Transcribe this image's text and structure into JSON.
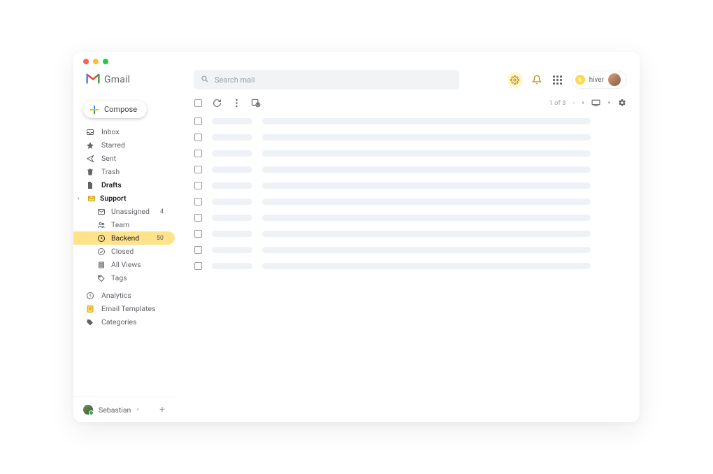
{
  "app": {
    "name": "Gmail"
  },
  "search": {
    "placeholder": "Search mail"
  },
  "compose": {
    "label": "Compose"
  },
  "hiver": {
    "label": "hiver"
  },
  "nav": [
    {
      "id": "inbox",
      "label": "Inbox",
      "icon": "inbox-icon",
      "bold": false
    },
    {
      "id": "starred",
      "label": "Starred",
      "icon": "star-icon",
      "bold": false
    },
    {
      "id": "sent",
      "label": "Sent",
      "icon": "send-icon",
      "bold": false
    },
    {
      "id": "trash",
      "label": "Trash",
      "icon": "trash-icon",
      "bold": false
    },
    {
      "id": "drafts",
      "label": "Drafts",
      "icon": "file-icon",
      "bold": true
    }
  ],
  "support": {
    "label": "Support",
    "items": [
      {
        "id": "unassigned",
        "label": "Unassigned",
        "icon": "envelope-icon",
        "count": "4",
        "selected": false
      },
      {
        "id": "team",
        "label": "Team",
        "icon": "team-icon",
        "count": "",
        "selected": false
      },
      {
        "id": "backend",
        "label": "Backend",
        "icon": "clock-icon",
        "count": "50",
        "selected": true
      },
      {
        "id": "closed",
        "label": "Closed",
        "icon": "check-icon",
        "count": "",
        "selected": false
      },
      {
        "id": "allviews",
        "label": "All Views",
        "icon": "stack-icon",
        "count": "",
        "selected": false
      },
      {
        "id": "tags",
        "label": "Tags",
        "icon": "tag-icon",
        "count": "",
        "selected": false
      }
    ]
  },
  "lower_nav": [
    {
      "id": "analytics",
      "label": "Analytics",
      "icon": "clock-icon"
    },
    {
      "id": "templates",
      "label": "Email Templates",
      "icon": "templates-icon"
    },
    {
      "id": "categories",
      "label": "Categories",
      "icon": "tag-solid-icon"
    }
  ],
  "user": {
    "name": "Sebastian"
  },
  "toolbar": {
    "page_info": "1 of 3"
  },
  "rows": 10
}
